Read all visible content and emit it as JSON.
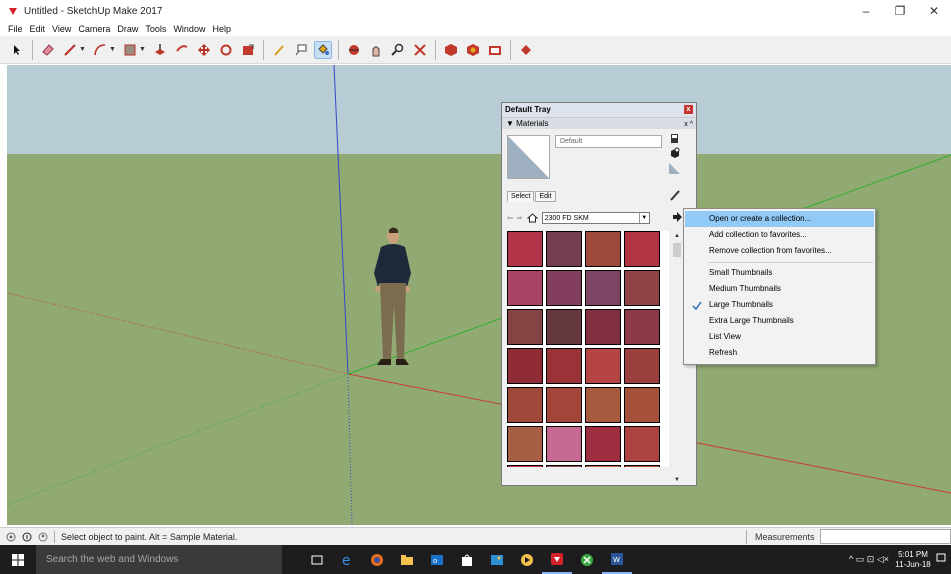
{
  "window": {
    "title": "Untitled - SketchUp Make 2017",
    "minimize": "–",
    "maximize": "❐",
    "close": "✕"
  },
  "menu": [
    "File",
    "Edit",
    "View",
    "Camera",
    "Draw",
    "Tools",
    "Window",
    "Help"
  ],
  "toolbar": {
    "tools": [
      "select-icon",
      "eraser-icon",
      "line-icon",
      "arc-icon",
      "rectangle-icon",
      "push-pull-icon",
      "offset-icon",
      "move-icon",
      "rotate-icon",
      "scale-icon",
      "tape-measure-icon",
      "text-icon",
      "paint-bucket-icon",
      "orbit-icon",
      "pan-icon",
      "zoom-icon",
      "zoom-extents-icon",
      "3d-warehouse-icon",
      "extension-warehouse-icon",
      "layout-icon",
      "extension-manager-icon"
    ],
    "active_tool": "paint-bucket-icon"
  },
  "tray": {
    "title": "Default Tray",
    "close_label": "x",
    "section_title": "▼ Materials",
    "section_buttons": "x ^",
    "material_name": "Default",
    "tabs": [
      "Select",
      "Edit"
    ],
    "collection": "2300 FD SKM",
    "swatch_colors": [
      "#b13449",
      "#733e4e",
      "#9d4a3d",
      "#b13442",
      "#a84364",
      "#823e5c",
      "#7c4565",
      "#8e4446",
      "#864343",
      "#65383d",
      "#812e41",
      "#8d3947",
      "#902c36",
      "#9a3338",
      "#b54543",
      "#9a3f3b",
      "#a0493b",
      "#a3453a",
      "#a85a3f",
      "#a5503b",
      "#a65e44",
      "#c56992",
      "#9e2e3f",
      "#ac4340",
      "#bd3c47",
      "#90514a",
      "#c86a52",
      "#b2523f"
    ]
  },
  "context_menu": {
    "items": [
      {
        "label": "Open or create a collection...",
        "highlight": true
      },
      {
        "label": "Add collection to favorites..."
      },
      {
        "label": "Remove collection from favorites..."
      },
      {
        "label": "Small Thumbnails"
      },
      {
        "label": "Medium Thumbnails"
      },
      {
        "label": "Large Thumbnails",
        "checked": true
      },
      {
        "label": "Extra Large Thumbnails"
      },
      {
        "label": "List View"
      },
      {
        "label": "Refresh"
      }
    ]
  },
  "status": {
    "message": "Select object to paint. Alt = Sample Material.",
    "measurements_label": "Measurements",
    "measurements_value": ""
  },
  "taskbar": {
    "search_placeholder": "Search the web and Windows",
    "apps": [
      "task-view-icon",
      "edge-icon",
      "firefox-icon",
      "file-explorer-icon",
      "outlook-icon",
      "store-icon",
      "photos-icon",
      "media-icon",
      "sketchup-icon",
      "xbox-icon",
      "word-icon"
    ],
    "open_apps": [
      "sketchup-icon",
      "word-icon"
    ],
    "tray_icons": "^ ▭ ⊡ ◁×",
    "time": "5:01 PM",
    "date": "11-Jun-18"
  },
  "colors": {
    "sky": "#b7ccd5",
    "ground": "#91aa73",
    "axis_red": "#c83b3b",
    "axis_green": "#2fae2a",
    "axis_blue": "#3548c7",
    "menu_highlight": "#91c9f7",
    "taskbar": "#1d1d1f"
  }
}
